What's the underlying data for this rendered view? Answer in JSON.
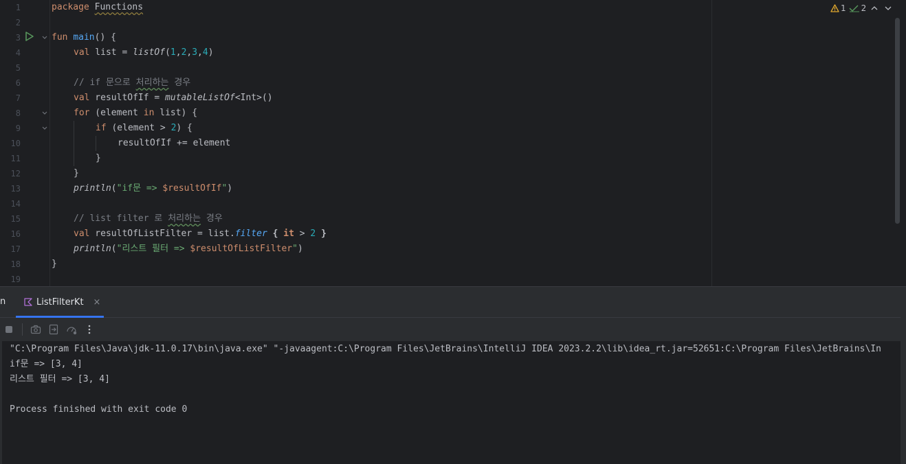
{
  "editor": {
    "line_numbers": [
      "1",
      "2",
      "3",
      "4",
      "5",
      "6",
      "7",
      "8",
      "9",
      "10",
      "11",
      "12",
      "13",
      "14",
      "15",
      "16",
      "17",
      "18",
      "19"
    ],
    "code": {
      "l1_kw": "package",
      "l1_pkg": "Functions",
      "l3_kw": "fun",
      "l3_fn": "main",
      "l3_rest": "() {",
      "l4_kw": "val",
      "l4_a": " list = ",
      "l4_call": "listOf",
      "l4_p1": "(",
      "l4_n1": "1",
      "l4_c1": ",",
      "l4_n2": "2",
      "l4_c2": ",",
      "l4_n3": "3",
      "l4_c3": ",",
      "l4_n4": "4",
      "l4_p2": ")",
      "l6_cmt_a": "// if 문으로 ",
      "l6_cmt_b": "처리하는",
      "l6_cmt_c": " 경우",
      "l7_kw": "val",
      "l7_a": " resultOfIf = ",
      "l7_call": "mutableListOf",
      "l7_b": "<Int>()",
      "l8_kw": "for",
      "l8_a": " (element ",
      "l8_kw2": "in",
      "l8_b": " list) {",
      "l9_kw": "if",
      "l9_a": " (element > ",
      "l9_num": "2",
      "l9_b": ") {",
      "l10": "resultOfIf += element",
      "l11": "}",
      "l12": "}",
      "l13_call": "println",
      "l13_a": "(",
      "l13_str": "\"if문 => ",
      "l13_var": "$resultOfIf",
      "l13_str2": "\"",
      "l13_b": ")",
      "l15_cmt_a": "// list filter 로 ",
      "l15_cmt_b": "처리하는",
      "l15_cmt_c": " 경우",
      "l16_kw": "val",
      "l16_a": " resultOfListFilter = list.",
      "l16_ext": "filter",
      "l16_b1": " ",
      "l16_br1": "{",
      "l16_it": " it",
      "l16_c": " > ",
      "l16_num": "2",
      "l16_d": " ",
      "l16_br2": "}",
      "l17_call": "println",
      "l17_a": "(",
      "l17_str": "\"리스트 필터 => ",
      "l17_var": "$resultOfListFilter",
      "l17_str2": "\"",
      "l17_b": ")",
      "l18": "}"
    },
    "inspections": {
      "warnings": "1",
      "checks": "2"
    }
  },
  "run": {
    "cut_tab_label": "n",
    "tab_label": "ListFilterKt",
    "tab_close": "×",
    "console_lines": [
      "\"C:\\Program Files\\Java\\jdk-11.0.17\\bin\\java.exe\" \"-javaagent:C:\\Program Files\\JetBrains\\IntelliJ IDEA 2023.2.2\\lib\\idea_rt.jar=52651:C:\\Program Files\\JetBrains\\In",
      "if문 => [3, 4]",
      "리스트 필터 => [3, 4]",
      "",
      "Process finished with exit code 0"
    ]
  },
  "colors": {
    "background": "#1e1f22",
    "keyword": "#cf8e6d",
    "function": "#56a8f5",
    "number": "#2aacb8",
    "string": "#6aab73",
    "comment": "#7a7e85",
    "accent": "#3574f0"
  },
  "icons": [
    "run-icon",
    "fold-icon",
    "warning-icon",
    "check-icon",
    "chevron-up-icon",
    "chevron-down-icon",
    "kotlin-file-icon",
    "close-icon",
    "stop-icon",
    "camera-icon",
    "exit-to-icon",
    "restart-icon",
    "more-icon"
  ]
}
